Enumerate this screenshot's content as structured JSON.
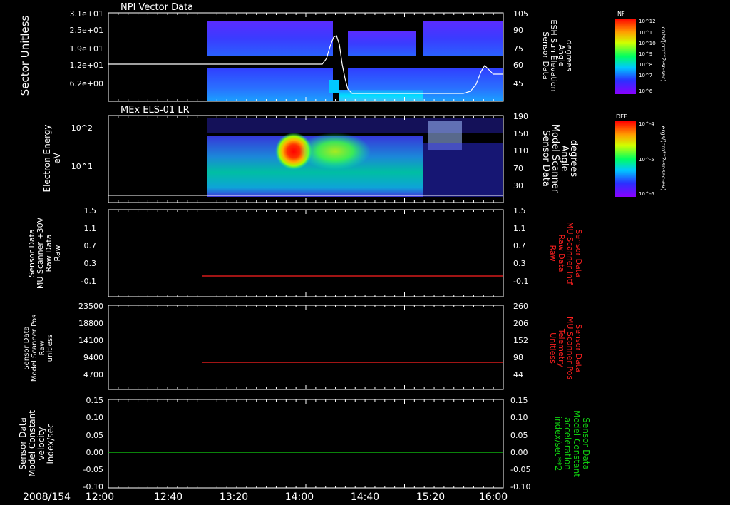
{
  "chart_data": [
    {
      "type": "heatmap",
      "title": "NPI Vector Data",
      "ylabel": "Sector Unitless",
      "yticks": [
        "3.1e+01",
        "2.5e+01",
        "1.9e+01",
        "1.2e+01",
        "6.2e+00"
      ],
      "right_ylabel": [
        "Sensor Data",
        "ESH Sun Elevation",
        "Angle",
        "degrees"
      ],
      "right_yticks": [
        "105",
        "90",
        "75",
        "60",
        "45"
      ],
      "colorbar": {
        "label": "NF",
        "units": "cnts/(cm**2-sr-sec)",
        "ticks": [
          "10^12",
          "10^11",
          "10^10",
          "10^9",
          "10^8",
          "10^7",
          "10^6"
        ]
      }
    },
    {
      "type": "heatmap",
      "title": "MEx ELS-01 LR",
      "ylabel": [
        "Electron Energy",
        "eV"
      ],
      "yticks": [
        "10^2",
        "10^1"
      ],
      "right_ylabel": [
        "Sensor Data",
        "Model Scanner",
        "Angle",
        "degrees"
      ],
      "right_yticks": [
        "190",
        "150",
        "110",
        "70",
        "30"
      ],
      "colorbar": {
        "label": "DEF",
        "units": "ergs/(cm**2-sr-sec-eV)",
        "ticks": [
          "10^-4",
          "10^-5",
          "10^-6"
        ]
      }
    },
    {
      "type": "line",
      "ylabel": [
        "Sensor Data",
        "MU Scanner +30V",
        "Raw Data",
        "Raw"
      ],
      "yticks": [
        "1.5",
        "1.1",
        "0.7",
        "0.3",
        "-0.1"
      ],
      "right_ylabel": [
        "Sensor Data",
        "MU Scanner Intf",
        "Raw Data",
        "Raw"
      ],
      "right_yticks": [
        "1.5",
        "1.1",
        "0.7",
        "0.3",
        "-0.1"
      ],
      "series": [
        {
          "name": "",
          "x": [
            "13:00",
            "16:00"
          ],
          "y": [
            0.0,
            0.0
          ],
          "color": "#ff2020"
        }
      ]
    },
    {
      "type": "line",
      "ylabel": [
        "Sensor Data",
        "Model Scanner Pos",
        "Raw",
        "unitless"
      ],
      "yticks": [
        "23500",
        "18800",
        "14100",
        "9400",
        "4700"
      ],
      "right_ylabel": [
        "Sensor Data",
        "MU Scanner Pos",
        "Telemetry",
        "Unitless"
      ],
      "right_yticks": [
        "260",
        "206",
        "152",
        "98",
        "44"
      ],
      "series": [
        {
          "name": "",
          "x": [
            "13:00",
            "16:00"
          ],
          "y": [
            8000,
            8000
          ],
          "color": "#ff2020"
        }
      ]
    },
    {
      "type": "line",
      "ylabel": [
        "Sensor Data",
        "Model Constant",
        "velocity",
        "index/sec"
      ],
      "yticks": [
        "0.15",
        "0.10",
        "0.05",
        "0.00",
        "-0.05",
        "-0.10"
      ],
      "right_ylabel": [
        "Sensor Data",
        "Model Constant",
        "acceleration",
        "index/sec**2"
      ],
      "right_yticks": [
        "0.15",
        "0.10",
        "0.05",
        "0.00",
        "-0.05",
        "-0.10"
      ],
      "series": [
        {
          "name": "",
          "x": [
            "12:00",
            "16:00"
          ],
          "y": [
            0.0,
            0.0
          ],
          "color": "#10d010"
        }
      ]
    }
  ],
  "x_axis": {
    "date": "2008/154",
    "ticks": [
      "12:00",
      "12:40",
      "13:20",
      "14:00",
      "14:40",
      "15:20",
      "16:00"
    ]
  },
  "colors": {
    "background": "#000000",
    "red": "#ff2020",
    "green": "#10d010",
    "white": "#ffffff"
  }
}
